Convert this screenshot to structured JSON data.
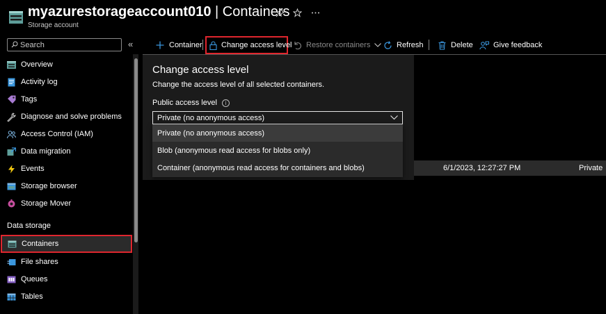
{
  "header": {
    "resource_name": "myazurestorageaccount010",
    "separator": " | ",
    "page_name": "Containers",
    "subtitle": "Storage account"
  },
  "sidebar": {
    "search_placeholder": "Search",
    "collapse_glyph": "«",
    "items_top": [
      {
        "label": "Overview",
        "icon": "overview-icon"
      },
      {
        "label": "Activity log",
        "icon": "activity-log-icon"
      },
      {
        "label": "Tags",
        "icon": "tag-icon"
      },
      {
        "label": "Diagnose and solve problems",
        "icon": "wrench-icon"
      },
      {
        "label": "Access Control (IAM)",
        "icon": "people-icon"
      },
      {
        "label": "Data migration",
        "icon": "data-migration-icon"
      },
      {
        "label": "Events",
        "icon": "lightning-icon"
      },
      {
        "label": "Storage browser",
        "icon": "storage-browser-icon"
      },
      {
        "label": "Storage Mover",
        "icon": "storage-mover-icon"
      }
    ],
    "section_title": "Data storage",
    "items_data_storage": [
      {
        "label": "Containers",
        "icon": "containers-icon",
        "selected": true
      },
      {
        "label": "File shares",
        "icon": "file-shares-icon"
      },
      {
        "label": "Queues",
        "icon": "queues-icon"
      },
      {
        "label": "Tables",
        "icon": "tables-icon"
      }
    ]
  },
  "toolbar": {
    "add_container": "Container",
    "change_access_level": "Change access level",
    "restore_containers": "Restore containers",
    "refresh": "Refresh",
    "delete": "Delete",
    "give_feedback": "Give feedback"
  },
  "panel": {
    "title": "Change access level",
    "description": "Change the access level of all selected containers.",
    "field_label": "Public access level",
    "selected_value": "Private (no anonymous access)",
    "options": [
      "Private (no anonymous access)",
      "Blob (anonymous read access for blobs only)",
      "Container (anonymous read access for containers and blobs)"
    ]
  },
  "table": {
    "row": {
      "last_modified": "6/1/2023, 12:27:27 PM",
      "access_level": "Private"
    }
  },
  "colors": {
    "background": "#000000",
    "panel": "#1b1b1b",
    "highlight_border": "#e0262e",
    "accent_blue": "#3a96dd"
  }
}
